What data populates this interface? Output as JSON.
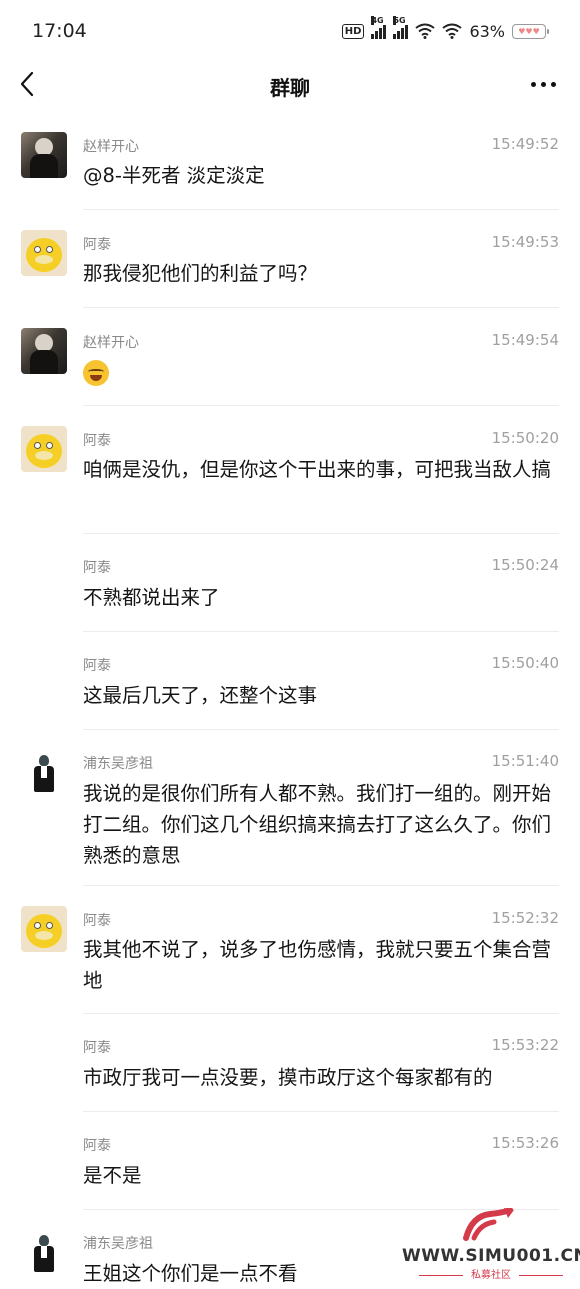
{
  "status_bar": {
    "time": "17:04",
    "hd_label": "HD",
    "net1_label": "4G",
    "net2_label": "5G",
    "battery_percent": "63%"
  },
  "nav": {
    "title": "群聊"
  },
  "messages": [
    {
      "sender": "赵样开心",
      "time": "15:49:52",
      "text": "@8-半死者 淡定淡定",
      "avatar": "photo"
    },
    {
      "sender": "阿泰",
      "time": "15:49:53",
      "text": "那我侵犯他们的利益了吗？",
      "avatar": "psyduck"
    },
    {
      "sender": "赵样开心",
      "time": "15:49:54",
      "emoji": "laughing-tears-emoji",
      "avatar": "photo"
    },
    {
      "sender": "阿泰",
      "time": "15:50:20",
      "text": "咱俩是没仇，但是你这个干出来的事，可把我当敌人搞",
      "avatar": "psyduck"
    },
    {
      "sender": "阿泰",
      "time": "15:50:24",
      "text": "不熟都说出来了"
    },
    {
      "sender": "阿泰",
      "time": "15:50:40",
      "text": "这最后几天了，还整个这事"
    },
    {
      "sender": "浦东吴彦祖",
      "time": "15:51:40",
      "text": "我说的是很你们所有人都不熟。我们打一组的。刚开始打二组。你们这几个组织搞来搞去打了这么久了。你们熟悉的意思",
      "avatar": "suit"
    },
    {
      "sender": "阿泰",
      "time": "15:52:32",
      "text": "我其他不说了，说多了也伤感情，我就只要五个集合营地",
      "avatar": "psyduck"
    },
    {
      "sender": "阿泰",
      "time": "15:53:22",
      "text": "市政厅我可一点没要，摸市政厅这个每家都有的"
    },
    {
      "sender": "阿泰",
      "time": "15:53:26",
      "text": "是不是"
    },
    {
      "sender": "浦东吴彦祖",
      "time": "",
      "text": "王姐这个你们是一点不看",
      "avatar": "suit"
    }
  ],
  "watermark": {
    "site": "WWW.SIMU001.CN",
    "sub": "私募社区"
  }
}
